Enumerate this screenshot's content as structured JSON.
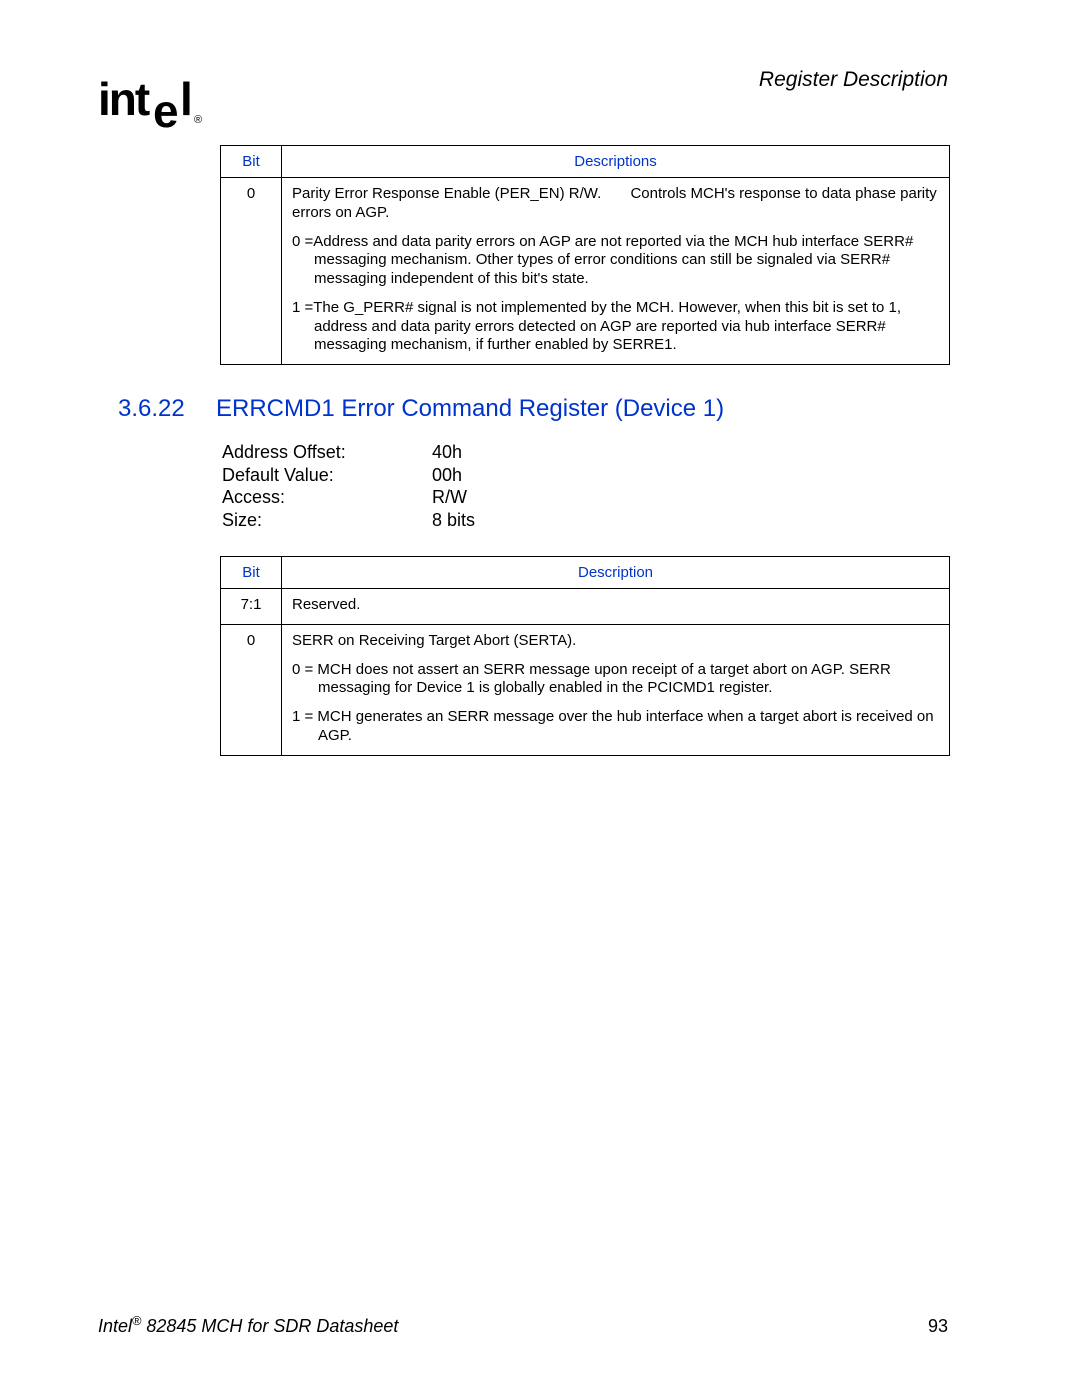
{
  "header": {
    "running_title": "Register Description"
  },
  "logo": {
    "text": "intel",
    "registered": "®"
  },
  "table1": {
    "headers": {
      "bit": "Bit",
      "desc": "Descriptions"
    },
    "row": {
      "bit": "0",
      "p1a": "Parity Error Response Enable (PER_EN) R/W.",
      "p1b": "Controls MCH's response to data phase parity errors on AGP.",
      "p2": "0 =Address and data parity errors on AGP are not reported via the MCH hub interface SERR# messaging mechanism. Other types of error conditions can still be signaled via SERR# messaging independent of this bit's state.",
      "p3": "1 =The G_PERR# signal is not implemented by the MCH. However, when this bit is set to 1, address and data parity errors detected on AGP are reported via hub interface SERR# messaging mechanism, if further enabled by SERRE1."
    }
  },
  "section": {
    "number": "3.6.22",
    "title": "ERRCMD1 Error Command Register (Device 1)"
  },
  "info": {
    "address_offset_label": "Address Offset:",
    "address_offset_value": "40h",
    "default_value_label": "Default Value:",
    "default_value_value": "00h",
    "access_label": "Access:",
    "access_value": "R/W",
    "size_label": "Size:",
    "size_value": "8 bits"
  },
  "table2": {
    "headers": {
      "bit": "Bit",
      "desc": "Description"
    },
    "row1": {
      "bit": "7:1",
      "desc": "Reserved."
    },
    "row2": {
      "bit": "0",
      "p1": "SERR on Receiving Target Abort (SERTA).",
      "p2": "0 = MCH does not assert an SERR message upon receipt of a target abort on AGP. SERR messaging for Device 1 is globally enabled in the PCICMD1 register.",
      "p3": "1 = MCH generates an SERR message over the hub interface when a target abort is received on AGP."
    }
  },
  "footer": {
    "doc": "Intel",
    "doc_after_reg": " 82845 MCH for SDR Datasheet",
    "reg": "®",
    "page": "93"
  }
}
